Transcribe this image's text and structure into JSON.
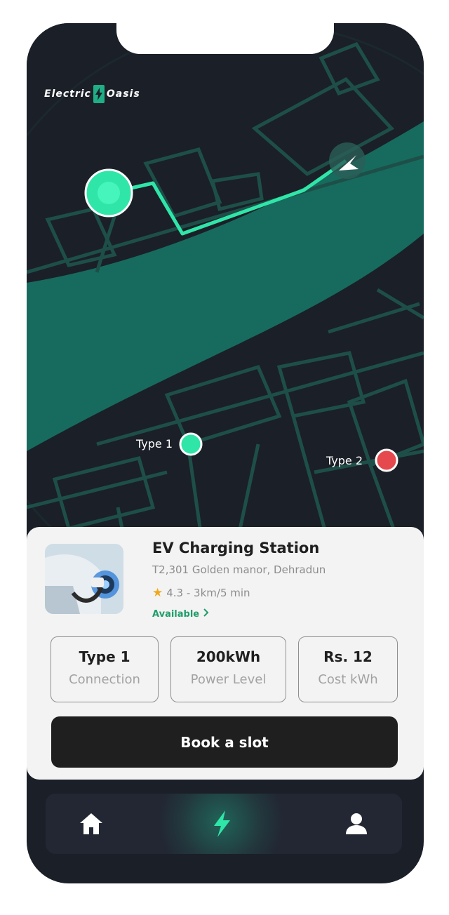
{
  "brand": {
    "name_left": "Electric",
    "name_right": "Oasis"
  },
  "map": {
    "pins": [
      {
        "label": "Type 1",
        "color": "#2fe6a8"
      },
      {
        "label": "Type 2",
        "color": "#e5484d"
      }
    ],
    "accent": "#2fe6a8",
    "road_color": "#176b5e",
    "background": "#1b1f27"
  },
  "station": {
    "name": "EV Charging Station",
    "address": "T2,301 Golden manor, Dehradun",
    "star_icon": "star-icon",
    "rating_text": "4.3 - 3km/5 min",
    "status": "Available",
    "specs": [
      {
        "value": "Type 1",
        "label": "Connection"
      },
      {
        "value": "200kWh",
        "label": "Power Level"
      },
      {
        "value": "Rs. 12",
        "label": "Cost kWh"
      }
    ],
    "book_label": "Book a slot"
  },
  "nav": {
    "items": [
      {
        "icon": "home-icon"
      },
      {
        "icon": "lightning-icon",
        "active": true
      },
      {
        "icon": "profile-icon"
      }
    ]
  }
}
